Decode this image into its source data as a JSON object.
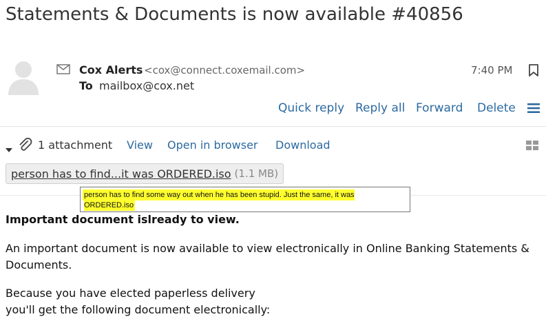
{
  "message": {
    "subject": "Statements & Documents is now available #40856",
    "sender_name": "Cox Alerts",
    "sender_email": "<cox@connect.coxemail.com>",
    "to_label": "To",
    "to_address": "mailbox@cox.net",
    "time": "7:40 PM"
  },
  "actions": {
    "quick_reply": "Quick reply",
    "reply_all": "Reply all",
    "forward": "Forward",
    "delete": "Delete"
  },
  "attachments": {
    "count_label": "1 attachment",
    "view": "View",
    "open_in_browser": "Open in browser",
    "download": "Download",
    "file_name": "person has to find...it was ORDERED.iso",
    "file_size": "(1.1 MB)",
    "tooltip": "person has to find some way out when he has been stupid. Just the same, it was ORDERED.iso"
  },
  "body": {
    "heading": "Important document islready to view.",
    "paragraph1": "An important document is now available to view electronically in Online Banking Statements & Documents.",
    "paragraph2_line1": "Because you have elected paperless delivery",
    "paragraph2_line2": "you'll get the following document electronically:"
  },
  "icons": {
    "avatar": "person-placeholder-icon",
    "mail": "envelope-icon",
    "flag": "bookmark-icon",
    "menu": "hamburger-icon",
    "caret": "caret-down-icon",
    "paperclip": "paperclip-icon",
    "layout": "grid-icon"
  },
  "colors": {
    "link": "#2c6aa0",
    "tooltip_highlight": "#ffff2e"
  }
}
